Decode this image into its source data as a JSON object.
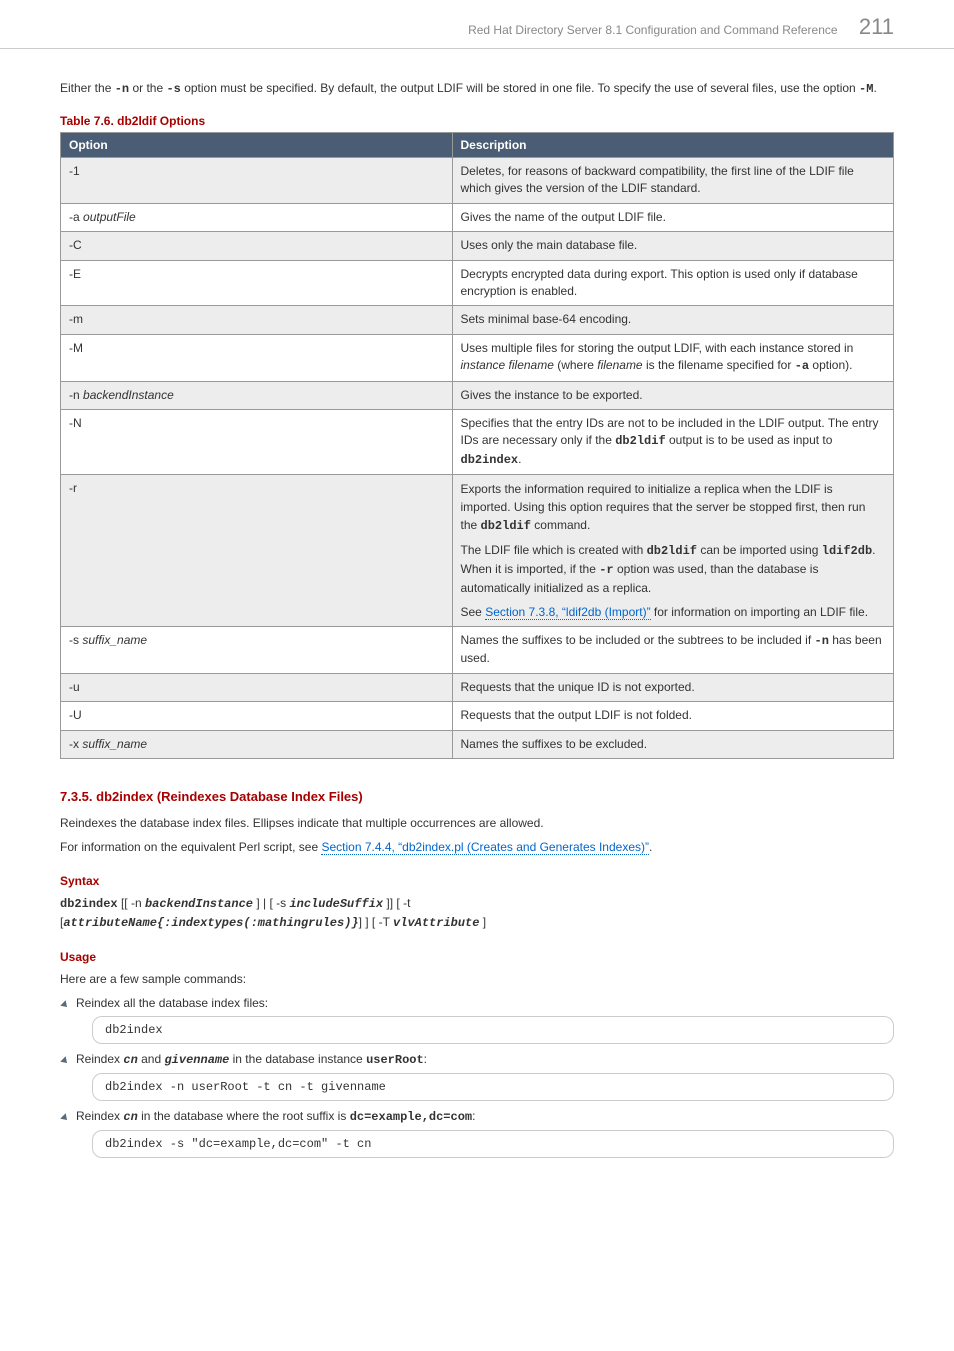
{
  "header": {
    "title": "Red Hat Directory Server 8.1 Configuration and Command Reference",
    "page": "211"
  },
  "intro": {
    "p1_a": "Either the ",
    "p1_b": "-n",
    "p1_c": " or the ",
    "p1_d": "-s",
    "p1_e": " option must be specified. By default, the output LDIF will be stored in one file. To specify the use of several files, use the option ",
    "p1_f": "-M",
    "p1_g": "."
  },
  "table": {
    "title": "Table 7.6. db2ldif Options",
    "col1": "Option",
    "col2": "Description",
    "rows": [
      {
        "opt": "-1",
        "desc_parts": [
          {
            "t": "Deletes, for reasons of backward compatibility, the first line of the LDIF file which gives the version of the LDIF standard."
          }
        ]
      },
      {
        "opt_html": "-a <span class='italic'>outputFile</span>",
        "desc_parts": [
          {
            "t": "Gives the name of the output LDIF file."
          }
        ]
      },
      {
        "opt": "-C",
        "desc_parts": [
          {
            "t": "Uses only the main database file."
          }
        ]
      },
      {
        "opt": "-E",
        "desc_parts": [
          {
            "t": "Decrypts encrypted data during export. This option is used only if database encryption is enabled."
          }
        ]
      },
      {
        "opt": "-m",
        "desc_parts": [
          {
            "t": "Sets minimal base-64 encoding."
          }
        ]
      },
      {
        "opt": "-M",
        "desc_parts": [
          {
            "t": "Uses multiple files for storing the output LDIF, with each instance stored in "
          },
          {
            "i": "instance filename"
          },
          {
            "t": " (where "
          },
          {
            "i": "filename"
          },
          {
            "t": " is the filename specified for "
          },
          {
            "mb": "-a"
          },
          {
            "t": " option)."
          }
        ]
      },
      {
        "opt_html": "-n <span class='italic'>backendInstance</span>",
        "desc_parts": [
          {
            "t": "Gives the instance to be exported."
          }
        ]
      },
      {
        "opt": "-N",
        "desc_parts": [
          {
            "t": "Specifies that the entry IDs are not to be included in the LDIF output. The entry IDs are necessary only if the "
          },
          {
            "mb": "db2ldif"
          },
          {
            "t": " output is to be used as input to "
          },
          {
            "mb": "db2index"
          },
          {
            "t": "."
          }
        ]
      },
      {
        "opt": "-r",
        "multipara": [
          [
            {
              "t": "Exports the information required to initialize a replica when the LDIF is imported. Using this option requires that the server be stopped first, then run the "
            },
            {
              "mb": "db2ldif"
            },
            {
              "t": " command."
            }
          ],
          [
            {
              "t": "The LDIF file which is created with "
            },
            {
              "mb": "db2ldif"
            },
            {
              "t": " can be imported using "
            },
            {
              "mb": "ldif2db"
            },
            {
              "t": ". When it is imported, if the "
            },
            {
              "mb": "-r"
            },
            {
              "t": " option was used, than the database is automatically initialized as a replica."
            }
          ],
          [
            {
              "t": "See "
            },
            {
              "link": "Section 7.3.8, “ldif2db (Import)”"
            },
            {
              "t": " for information on importing an LDIF file."
            }
          ]
        ]
      },
      {
        "opt_html": "-s <span class='italic'>suffix_name</span>",
        "desc_parts": [
          {
            "t": "Names the suffixes to be included or the subtrees to be included if "
          },
          {
            "mb": "-n"
          },
          {
            "t": " has been used."
          }
        ]
      },
      {
        "opt": "-u",
        "desc_parts": [
          {
            "t": "Requests that the unique ID is not exported."
          }
        ]
      },
      {
        "opt": "-U",
        "desc_parts": [
          {
            "t": "Requests that the output LDIF is not folded."
          }
        ]
      },
      {
        "opt_html": "-x <span class='italic'>suffix_name</span>",
        "desc_parts": [
          {
            "t": "Names the suffixes to be excluded."
          }
        ]
      }
    ]
  },
  "sect735": {
    "heading": "7.3.5. db2index (Reindexes Database Index Files)",
    "p1": "Reindexes the database index files. Ellipses indicate that multiple occurrences are allowed.",
    "p2_a": "For information on the equivalent Perl script, see ",
    "p2_link": "Section 7.4.4, “db2index.pl (Creates and Generates Indexes)”",
    "p2_b": "."
  },
  "syntax": {
    "heading": "Syntax",
    "cmd": "db2index",
    "parts": {
      "a": " [[ -n ",
      "b": "backendInstance",
      "c": " ] | [ -s ",
      "d": "includeSuffix",
      "e": " ]]  [ -t ",
      "f": "[",
      "g": "attributeName{:indextypes(:mathingrules)}",
      "h": "] ]  [ -T ",
      "i": "vlvAttribute",
      "j": " ]"
    }
  },
  "usage": {
    "heading": "Usage",
    "intro": "Here are a few sample commands:",
    "items": [
      {
        "label_parts": [
          {
            "t": "Reindex all the database index files:"
          }
        ],
        "code": "db2index"
      },
      {
        "label_parts": [
          {
            "t": "Reindex "
          },
          {
            "mbi": "cn"
          },
          {
            "t": " and "
          },
          {
            "mbi": "givenname"
          },
          {
            "t": " in the database instance "
          },
          {
            "mb": "userRoot"
          },
          {
            "t": ":"
          }
        ],
        "code": "db2index -n userRoot -t cn -t givenname"
      },
      {
        "label_parts": [
          {
            "t": "Reindex "
          },
          {
            "mbi": "cn"
          },
          {
            "t": " in the database where the root suffix is "
          },
          {
            "mb": "dc=example,dc=com"
          },
          {
            "t": ":"
          }
        ],
        "code": "db2index -s \"dc=example,dc=com\" -t cn"
      }
    ]
  }
}
